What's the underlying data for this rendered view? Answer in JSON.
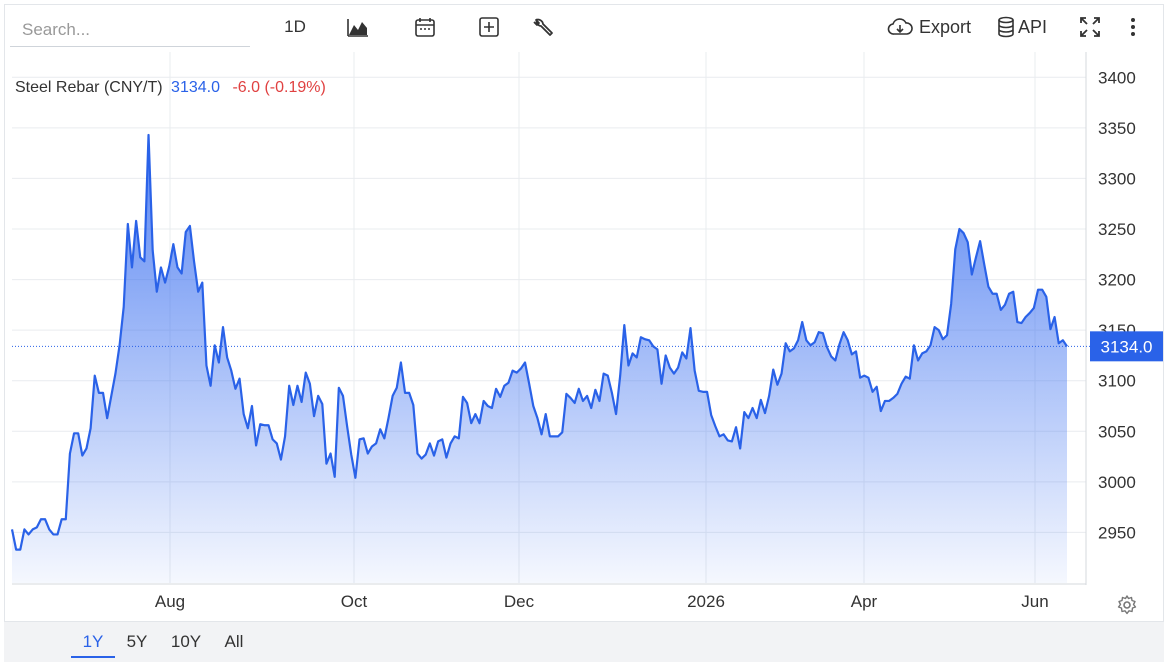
{
  "search": {
    "placeholder": "Search..."
  },
  "toolbar": {
    "interval_label": "1D",
    "chart_type_icon": "area-chart-icon",
    "calendar_icon": "calendar-icon",
    "compare_icon": "plus-box-icon",
    "tools_icon": "wrench-icon",
    "export_label": "Export",
    "api_label": "API",
    "fullscreen_icon": "fullscreen-icon",
    "more_icon": "more-vertical-icon"
  },
  "legend": {
    "name": "Steel Rebar (CNY/T)",
    "last": "3134.0",
    "change": "-6.0 (-0.19%)"
  },
  "ranges": [
    {
      "label": "1Y",
      "active": true
    },
    {
      "label": "5Y",
      "active": false
    },
    {
      "label": "10Y",
      "active": false
    },
    {
      "label": "All",
      "active": false
    }
  ],
  "colors": {
    "line": "#2a62e8",
    "area_top": "#3a6ff0",
    "price_tag_bg": "#2a62e8",
    "change_negative": "#e04141",
    "grid": "#e9ecef"
  },
  "chart_data": {
    "type": "area",
    "series": [
      {
        "values": [
          2953,
          2933,
          2933,
          2953,
          2948,
          2953,
          2955,
          2963,
          2963,
          2953,
          2948,
          2948,
          2963,
          2963,
          3028,
          3048,
          3048,
          3026,
          3033,
          3053,
          3105,
          3088,
          3088,
          3063,
          3085,
          3107,
          3135,
          3173,
          3255,
          3212,
          3258,
          3222,
          3218,
          3343,
          3229,
          3188,
          3212,
          3197,
          3213,
          3235,
          3212,
          3206,
          3247,
          3253,
          3218,
          3188,
          3197,
          3115,
          3095,
          3135,
          3118,
          3153,
          3123,
          3110,
          3092,
          3102,
          3067,
          3053,
          3075,
          3036,
          3057,
          3056,
          3056,
          3042,
          3038,
          3022,
          3045,
          3095,
          3076,
          3095,
          3079,
          3108,
          3097,
          3065,
          3085,
          3077,
          3018,
          3028,
          3005,
          3093,
          3085,
          3055,
          3027,
          3004,
          3042,
          3043,
          3028,
          3035,
          3038,
          3052,
          3043,
          3063,
          3085,
          3093,
          3118,
          3088,
          3088,
          3076,
          3028,
          3023,
          3027,
          3038,
          3026,
          3040,
          3042,
          3024,
          3038,
          3045,
          3043,
          3084,
          3078,
          3058,
          3067,
          3058,
          3080,
          3075,
          3073,
          3092,
          3084,
          3095,
          3098,
          3110,
          3108,
          3112,
          3118,
          3097,
          3075,
          3063,
          3047,
          3067,
          3045,
          3045,
          3045,
          3049,
          3087,
          3083,
          3078,
          3092,
          3080,
          3085,
          3073,
          3091,
          3080,
          3107,
          3105,
          3088,
          3067,
          3105,
          3155,
          3115,
          3127,
          3123,
          3143,
          3141,
          3140,
          3134,
          3131,
          3097,
          3125,
          3113,
          3107,
          3113,
          3128,
          3122,
          3152,
          3110,
          3090,
          3089,
          3089,
          3066,
          3055,
          3045,
          3047,
          3041,
          3040,
          3054,
          3033,
          3069,
          3063,
          3073,
          3063,
          3081,
          3068,
          3085,
          3111,
          3096,
          3107,
          3137,
          3129,
          3132,
          3140,
          3158,
          3140,
          3135,
          3138,
          3148,
          3147,
          3133,
          3124,
          3120,
          3136,
          3148,
          3140,
          3126,
          3129,
          3103,
          3105,
          3103,
          3089,
          3094,
          3070,
          3080,
          3080,
          3083,
          3087,
          3097,
          3104,
          3102,
          3135,
          3120,
          3127,
          3129,
          3135,
          3153,
          3150,
          3141,
          3145,
          3176,
          3230,
          3250,
          3246,
          3237,
          3205,
          3222,
          3238,
          3215,
          3193,
          3186,
          3186,
          3170,
          3175,
          3186,
          3188,
          3158,
          3157,
          3163,
          3167,
          3172,
          3190,
          3190,
          3183,
          3151,
          3163,
          3137,
          3140,
          3134
        ]
      }
    ],
    "x_ticks": [
      "Aug",
      "Oct",
      "Dec",
      "2026",
      "Apr",
      "Jun"
    ],
    "y_ticks": [
      2950,
      3000,
      3050,
      3100,
      3150,
      3200,
      3250,
      3300,
      3350,
      3400
    ],
    "ylim": [
      2900,
      3425
    ],
    "last_price": 3134.0,
    "grid": true
  }
}
